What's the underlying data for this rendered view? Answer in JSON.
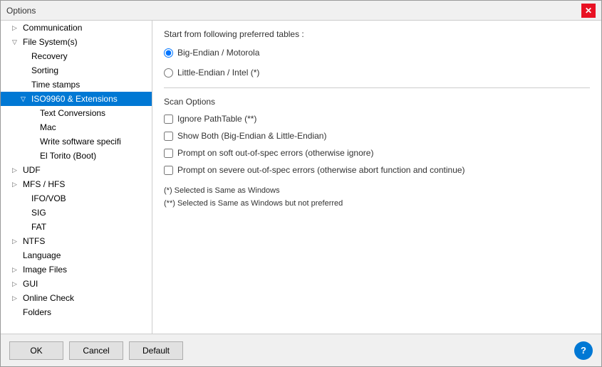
{
  "window": {
    "title": "Options",
    "close_label": "✕"
  },
  "tree": {
    "items": [
      {
        "id": "communication",
        "label": "Communication",
        "indent": 1,
        "arrow": "▷",
        "selected": false
      },
      {
        "id": "file-systems",
        "label": "File System(s)",
        "indent": 1,
        "arrow": "▽",
        "selected": false
      },
      {
        "id": "recovery",
        "label": "Recovery",
        "indent": 2,
        "arrow": "",
        "selected": false
      },
      {
        "id": "sorting",
        "label": "Sorting",
        "indent": 2,
        "arrow": "",
        "selected": false
      },
      {
        "id": "time-stamps",
        "label": "Time stamps",
        "indent": 2,
        "arrow": "",
        "selected": false
      },
      {
        "id": "iso9960",
        "label": "ISO9960 & Extensions",
        "indent": 2,
        "arrow": "▽",
        "selected": true
      },
      {
        "id": "text-conversions",
        "label": "Text Conversions",
        "indent": 3,
        "arrow": "",
        "selected": false
      },
      {
        "id": "mac",
        "label": "Mac",
        "indent": 3,
        "arrow": "",
        "selected": false
      },
      {
        "id": "write-software",
        "label": "Write software specifi",
        "indent": 3,
        "arrow": "",
        "selected": false
      },
      {
        "id": "el-torito",
        "label": "El Torito (Boot)",
        "indent": 3,
        "arrow": "",
        "selected": false
      },
      {
        "id": "udf",
        "label": "UDF",
        "indent": 1,
        "arrow": "▷",
        "selected": false
      },
      {
        "id": "mfs-hfs",
        "label": "MFS / HFS",
        "indent": 1,
        "arrow": "▷",
        "selected": false
      },
      {
        "id": "ifo-vob",
        "label": "IFO/VOB",
        "indent": 2,
        "arrow": "",
        "selected": false
      },
      {
        "id": "sig",
        "label": "SIG",
        "indent": 2,
        "arrow": "",
        "selected": false
      },
      {
        "id": "fat",
        "label": "FAT",
        "indent": 2,
        "arrow": "",
        "selected": false
      },
      {
        "id": "ntfs",
        "label": "NTFS",
        "indent": 1,
        "arrow": "▷",
        "selected": false
      },
      {
        "id": "language",
        "label": "Language",
        "indent": 1,
        "arrow": "",
        "selected": false
      },
      {
        "id": "image-files",
        "label": "Image Files",
        "indent": 1,
        "arrow": "▷",
        "selected": false
      },
      {
        "id": "gui",
        "label": "GUI",
        "indent": 1,
        "arrow": "▷",
        "selected": false
      },
      {
        "id": "online-check",
        "label": "Online Check",
        "indent": 1,
        "arrow": "▷",
        "selected": false
      },
      {
        "id": "folders",
        "label": "Folders",
        "indent": 1,
        "arrow": "",
        "selected": false
      }
    ]
  },
  "right": {
    "section_title": "Start from following preferred tables :",
    "radio1": {
      "label": "Big-Endian / Motorola",
      "checked": true
    },
    "radio2": {
      "label": "Little-Endian / Intel   (*)",
      "checked": false
    },
    "scan_options_title": "Scan Options",
    "checkboxes": [
      {
        "id": "ignore-path-table",
        "label": "Ignore PathTable  (**)",
        "checked": false
      },
      {
        "id": "show-both",
        "label": "Show Both (Big-Endian & Little-Endian)",
        "checked": false
      },
      {
        "id": "prompt-soft",
        "label": "Prompt on soft out-of-spec errors (otherwise ignore)",
        "checked": false
      },
      {
        "id": "prompt-severe",
        "label": "Prompt on severe out-of-spec errors (otherwise abort function and continue)",
        "checked": false
      }
    ],
    "note1": "(*) Selected is Same as Windows",
    "note2": "(**) Selected is Same as Windows but not preferred"
  },
  "buttons": {
    "ok": "OK",
    "cancel": "Cancel",
    "default": "Default",
    "help": "?"
  }
}
